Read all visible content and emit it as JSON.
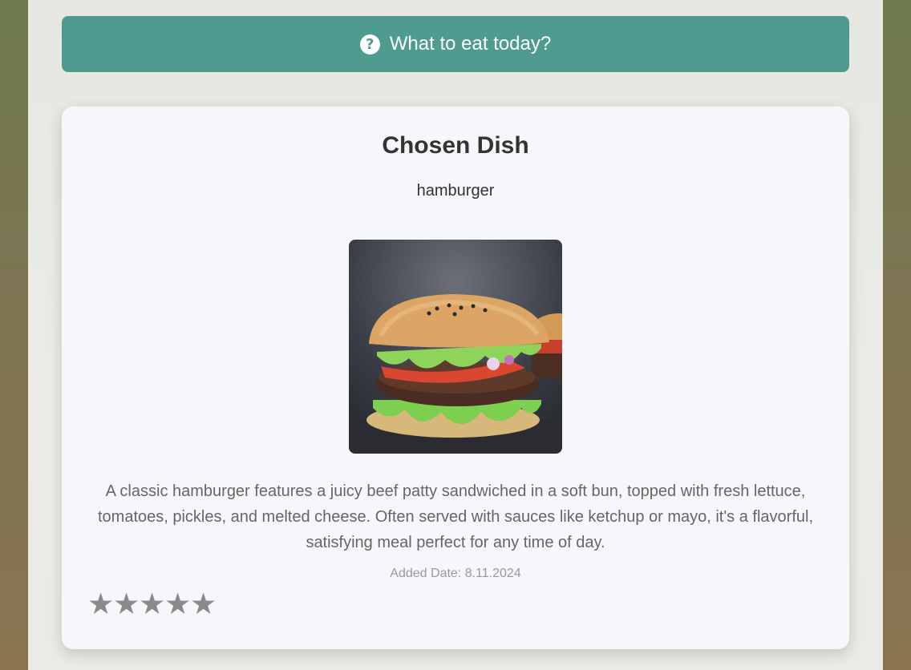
{
  "random_button": {
    "label": "What to eat today?",
    "icon": "question-circle-icon",
    "bg_color": "#4f9b8f"
  },
  "card": {
    "title": "Chosen Dish",
    "dish_name": "hamburger",
    "image_alt": "hamburger",
    "description": "A classic hamburger features a juicy beef patty sandwiched in a soft bun, topped with fresh lettuce, tomatoes, pickles, and melted cheese. Often served with sauces like ketchup or mayo, it's a flavorful, satisfying meal perfect for any time of day.",
    "added_date": "Added Date: 8.11.2024",
    "rating": {
      "max": 5,
      "value": 0,
      "star_glyph": "★",
      "star_color": "#8a8a8a"
    }
  }
}
